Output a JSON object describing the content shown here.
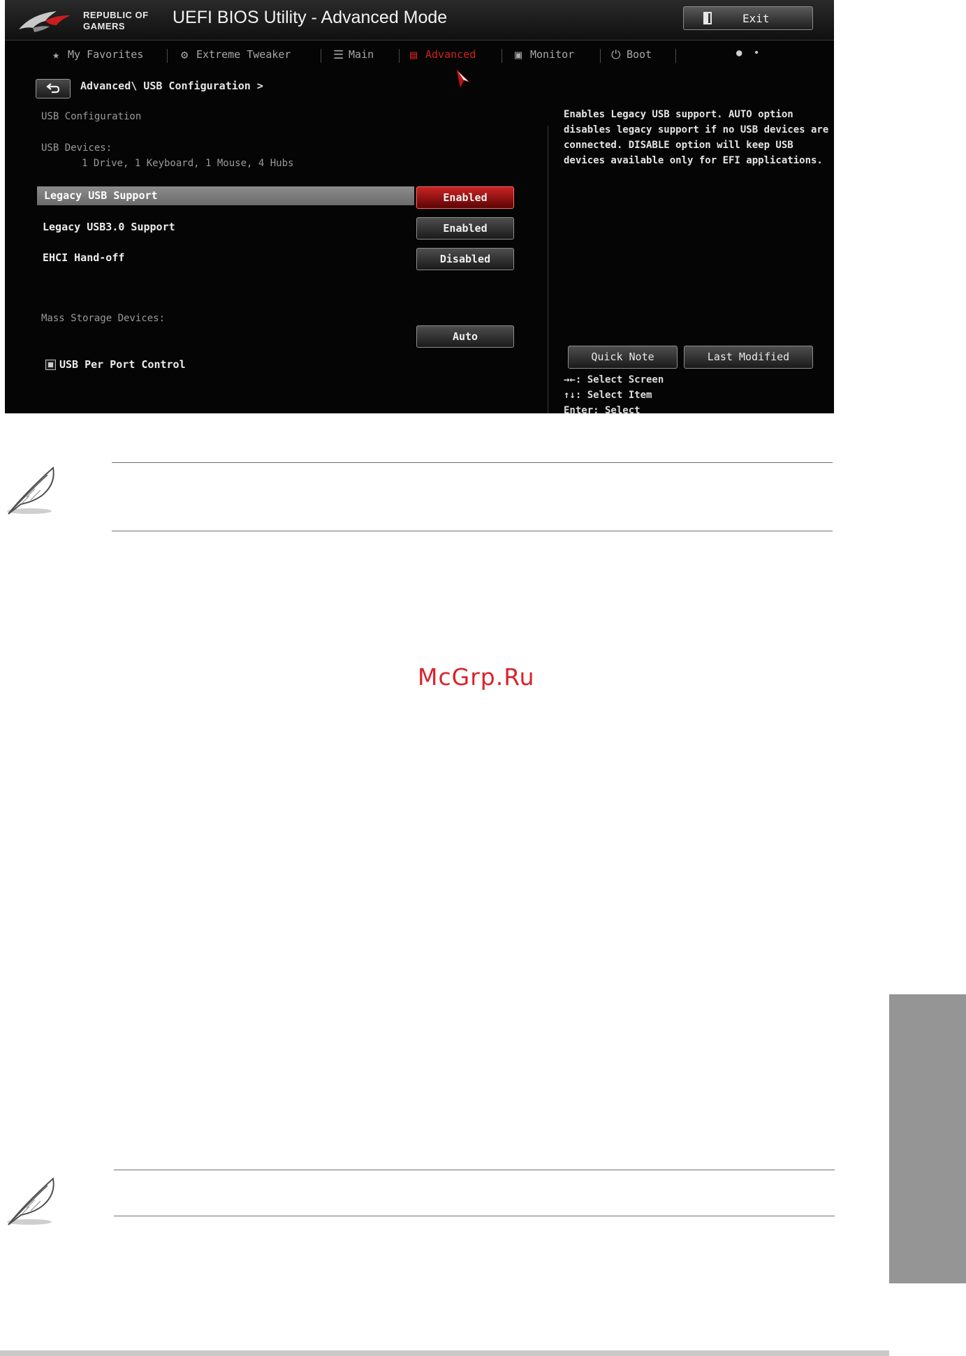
{
  "bios": {
    "brand_line1": "REPUBLIC OF",
    "brand_line2": "GAMERS",
    "title": "UEFI BIOS Utility - Advanced Mode",
    "exit_label": "Exit",
    "tabs": [
      {
        "label": "My Favorites",
        "icon": "star-icon"
      },
      {
        "label": "Extreme Tweaker",
        "icon": "tweaker-icon"
      },
      {
        "label": "Main",
        "icon": "list-icon"
      },
      {
        "label": "Advanced",
        "icon": "advanced-icon"
      },
      {
        "label": "Monitor",
        "icon": "monitor-icon"
      },
      {
        "label": "Boot",
        "icon": "power-icon"
      }
    ],
    "breadcrumb": "Advanced\\ USB Configuration >",
    "section_title": "USB Configuration",
    "devices_label": "USB Devices:",
    "devices_value": "1 Drive, 1 Keyboard, 1 Mouse, 4 Hubs",
    "items": [
      {
        "label": "Legacy USB Support",
        "value": "Enabled"
      },
      {
        "label": "Legacy USB3.0 Support",
        "value": "Enabled"
      },
      {
        "label": "EHCI Hand-off",
        "value": "Disabled"
      }
    ],
    "mass_storage_label": "Mass Storage Devices:",
    "mass_storage_value": "Auto",
    "per_port_label": "USB Per Port Control",
    "help_text": "Enables Legacy USB support. AUTO option disables legacy support if no USB devices are connected. DISABLE option will keep USB devices available only for EFI applications.",
    "quick_note_label": "Quick Note",
    "last_modified_label": "Last Modified",
    "key_hints": [
      "→←: Select Screen",
      "↑↓: Select Item",
      "Enter: Select"
    ]
  },
  "watermark": "McGrp.Ru",
  "colors": {
    "accent_red": "#d22020",
    "watermark_red": "#d8232a",
    "chapter_tab_gray": "#959595"
  }
}
